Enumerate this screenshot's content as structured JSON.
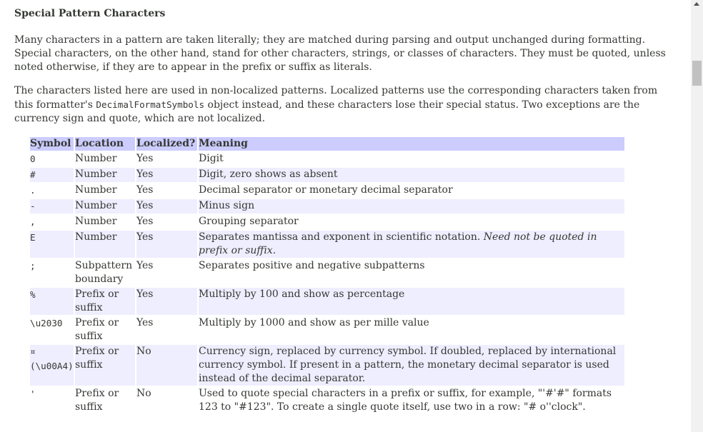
{
  "heading": "Special Pattern Characters",
  "para1": "Many characters in a pattern are taken literally; they are matched during parsing and output unchanged during formatting. Special characters, on the other hand, stand for other characters, strings, or classes of characters. They must be quoted, unless noted otherwise, if they are to appear in the prefix or suffix as literals.",
  "para2": {
    "before": "The characters listed here are used in non-localized patterns. Localized patterns use the corresponding characters taken from this formatter's ",
    "code": "DecimalFormatSymbols",
    "after": " object instead, and these characters lose their special status. Two exceptions are the currency sign and quote, which are not localized."
  },
  "table": {
    "headers": [
      "Symbol",
      "Location",
      "Localized?",
      "Meaning"
    ],
    "rows": [
      {
        "symbol": "0",
        "location": "Number",
        "localized": "Yes",
        "meaning": "Digit"
      },
      {
        "symbol": "#",
        "location": "Number",
        "localized": "Yes",
        "meaning": "Digit, zero shows as absent"
      },
      {
        "symbol": ".",
        "location": "Number",
        "localized": "Yes",
        "meaning": "Decimal separator or monetary decimal separator"
      },
      {
        "symbol": "-",
        "location": "Number",
        "localized": "Yes",
        "meaning": "Minus sign"
      },
      {
        "symbol": ",",
        "location": "Number",
        "localized": "Yes",
        "meaning": "Grouping separator"
      },
      {
        "symbol": "E",
        "location": "Number",
        "localized": "Yes",
        "meaning": "Separates mantissa and exponent in scientific notation. ",
        "meaning_em": "Need not be quoted in prefix or suffix."
      },
      {
        "symbol": ";",
        "location": "Subpattern boundary",
        "localized": "Yes",
        "meaning": "Separates positive and negative subpatterns"
      },
      {
        "symbol": "%",
        "location": "Prefix or suffix",
        "localized": "Yes",
        "meaning": "Multiply by 100 and show as percentage"
      },
      {
        "symbol": "\\u2030",
        "location": "Prefix or suffix",
        "localized": "Yes",
        "meaning": "Multiply by 1000 and show as per mille value"
      },
      {
        "symbol": "¤ (\\u00A4)",
        "location": "Prefix or suffix",
        "localized": "No",
        "meaning": "Currency sign, replaced by currency symbol. If doubled, replaced by international currency symbol. If present in a pattern, the monetary decimal separator is used instead of the decimal separator."
      },
      {
        "symbol": "'",
        "location": "Prefix or suffix",
        "localized": "No",
        "meaning": "Used to quote special characters in a prefix or suffix, for example, \"'#'#\" formats 123 to \"#123\". To create a single quote itself, use two in a row: \"# o''clock\"."
      }
    ]
  }
}
